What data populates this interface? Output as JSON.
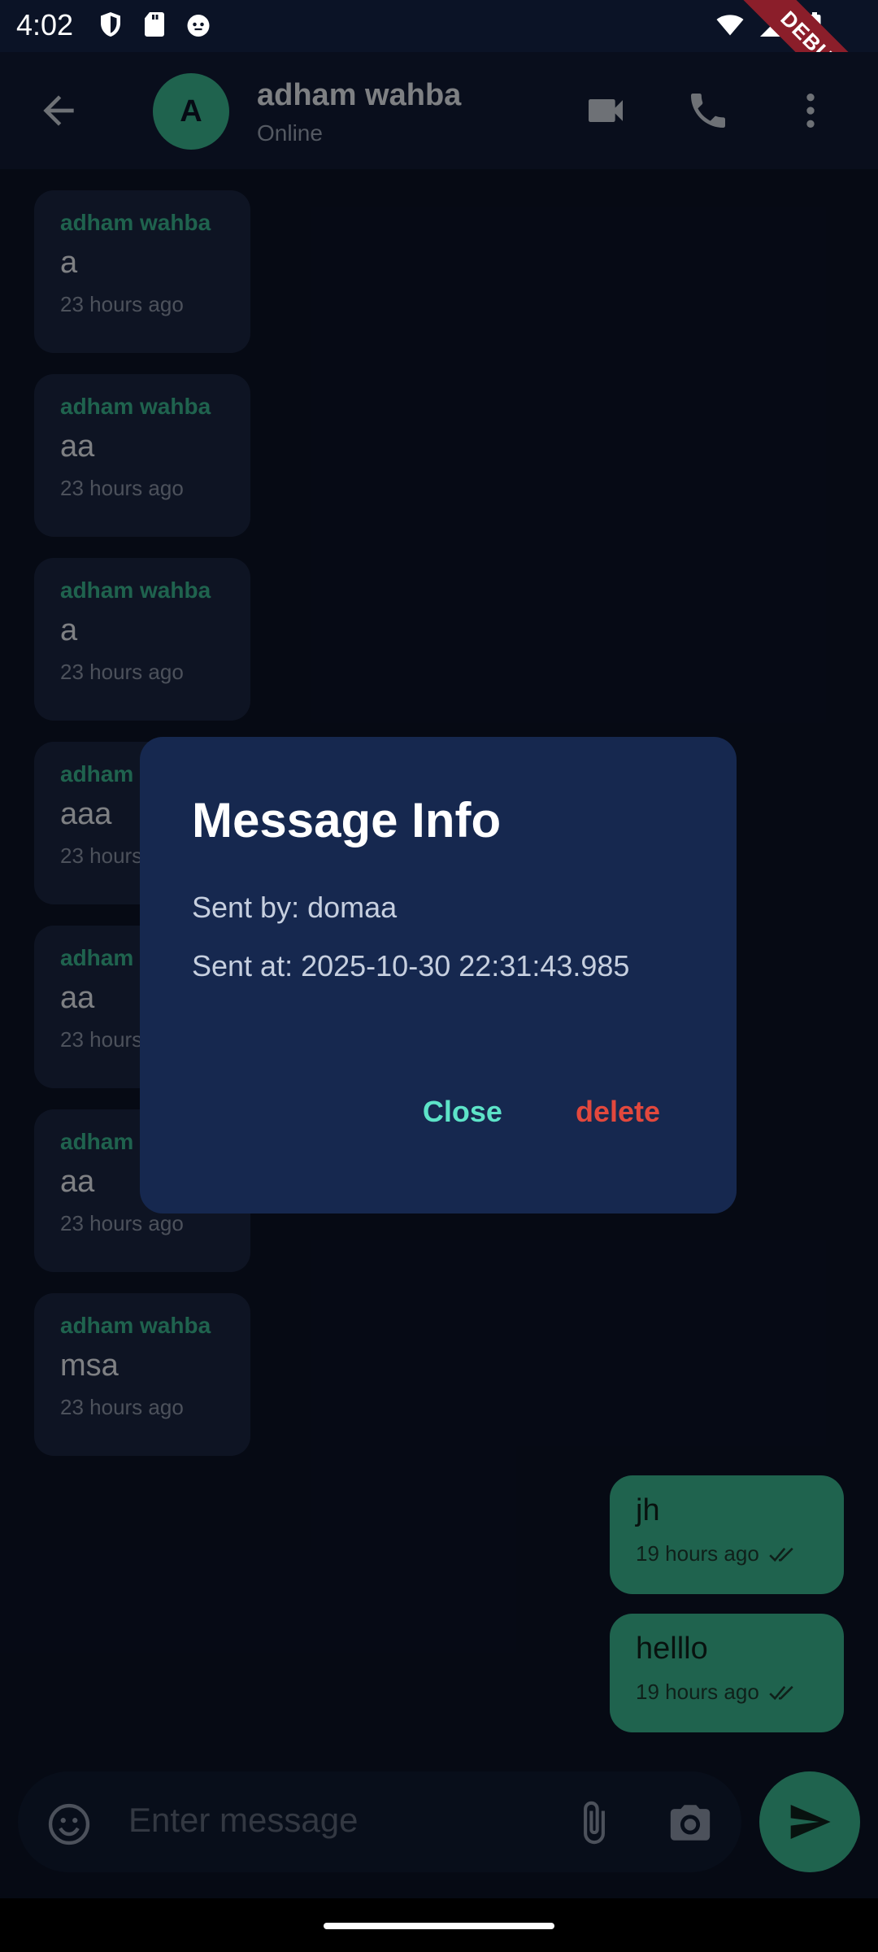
{
  "status_bar": {
    "time": "4:02",
    "debug_label": "DEBUG"
  },
  "header": {
    "avatar_letter": "A",
    "name": "adham wahba",
    "status": "Online"
  },
  "messages_in": [
    {
      "sender": "adham wahba",
      "text": "a",
      "time": "23 hours ago"
    },
    {
      "sender": "adham wahba",
      "text": "aa",
      "time": "23 hours ago"
    },
    {
      "sender": "adham wahba",
      "text": "a",
      "time": "23 hours ago"
    },
    {
      "sender": "adham wahba",
      "text": "aaa",
      "time": "23 hours ago"
    },
    {
      "sender": "adham wahba",
      "text": "aa",
      "time": "23 hours ago"
    },
    {
      "sender": "adham wahba",
      "text": "aa",
      "time": "23 hours ago"
    },
    {
      "sender": "adham wahba",
      "text": "msa",
      "time": "23 hours ago"
    }
  ],
  "messages_out": [
    {
      "text": "jh",
      "time": "19 hours ago"
    },
    {
      "text": "helllo",
      "time": "19 hours ago"
    }
  ],
  "composer": {
    "placeholder": "Enter message"
  },
  "dialog": {
    "title": "Message Info",
    "sent_by": "Sent by: domaa",
    "sent_at": "Sent at: 2025-10-30 22:31:43.985",
    "close_label": "Close",
    "delete_label": "delete"
  },
  "colors": {
    "accent": "#3ab58f",
    "background": "#0b1326",
    "dialog_bg": "#16284f",
    "close": "#5de3c8",
    "delete": "#e2483d"
  },
  "icons": [
    "arrow-back-icon",
    "videocam-icon",
    "phone-icon",
    "more-vert-icon",
    "emoji-icon",
    "attach-icon",
    "camera-icon",
    "send-icon",
    "double-check-icon"
  ]
}
